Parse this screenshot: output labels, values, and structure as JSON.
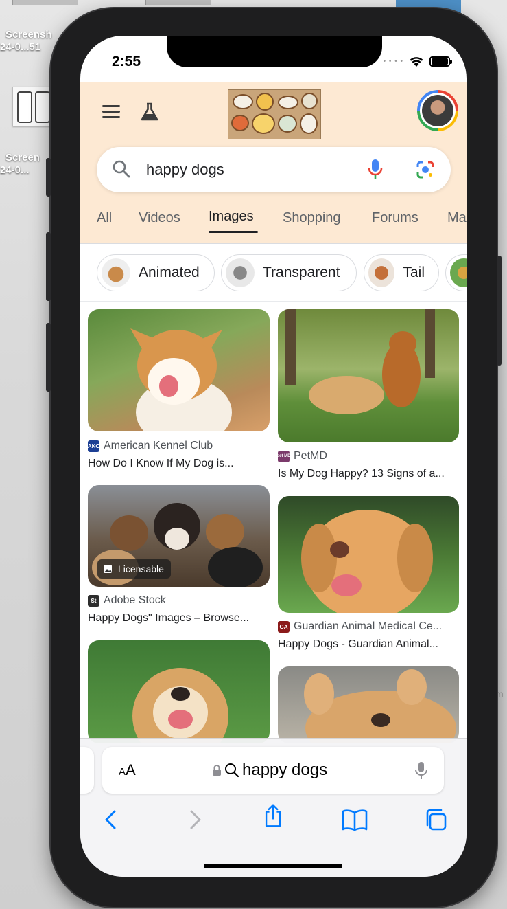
{
  "desktop": {
    "icons": [
      {
        "line1": "Screensh",
        "line2": "24-0...51"
      },
      {
        "line1": "Screen",
        "line2": "24-0..."
      }
    ],
    "edge_text": "m"
  },
  "status_bar": {
    "time": "2:55"
  },
  "search": {
    "query": "happy dogs"
  },
  "tabs": [
    {
      "label": "All",
      "active": false
    },
    {
      "label": "Videos",
      "active": false
    },
    {
      "label": "Images",
      "active": true
    },
    {
      "label": "Shopping",
      "active": false
    },
    {
      "label": "Forums",
      "active": false
    },
    {
      "label": "Ma",
      "active": false
    }
  ],
  "chips": [
    {
      "label": "Animated"
    },
    {
      "label": "Transparent"
    },
    {
      "label": "Tail"
    }
  ],
  "results": [
    {
      "source": "American Kennel Club",
      "favicon": "AKC",
      "favicon_color": "#1c3f94",
      "caption": "How Do I Know If My Dog is..."
    },
    {
      "source": "PetMD",
      "favicon": "pet MD",
      "favicon_color": "#7b3a6b",
      "caption": "Is My Dog Happy? 13 Signs of a..."
    },
    {
      "source": "Adobe Stock",
      "favicon": "St",
      "favicon_color": "#2d2d2d",
      "caption": "Happy Dogs\" Images – Browse...",
      "badge": "Licensable"
    },
    {
      "source": "Guardian Animal Medical Ce...",
      "favicon": "GA",
      "favicon_color": "#8b1a1a",
      "caption": "Happy Dogs - Guardian Animal..."
    }
  ],
  "safari": {
    "text_size_label": "AA",
    "address": "happy dogs"
  }
}
